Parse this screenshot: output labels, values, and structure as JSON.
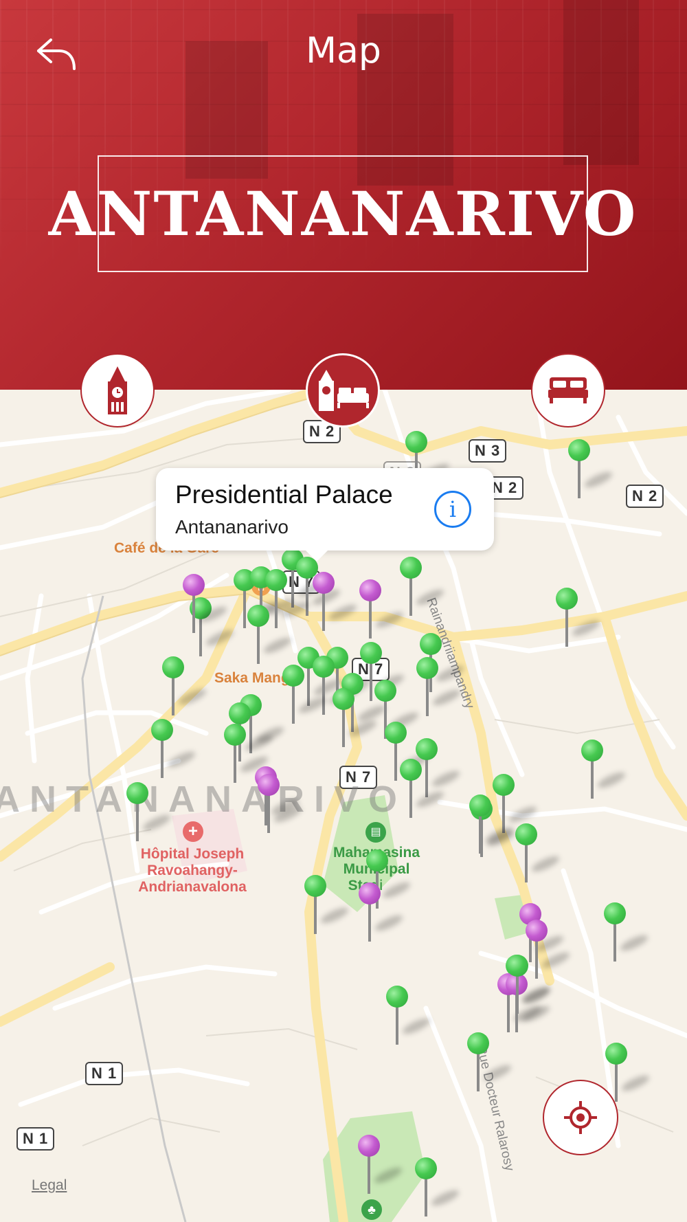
{
  "header": {
    "title": "Map",
    "city": "ANTANANARIVO",
    "back_icon": "back-arrow-icon"
  },
  "categories": [
    {
      "name": "attractions",
      "icon": "clock-tower-icon",
      "active": false
    },
    {
      "name": "attractions-and-hotels",
      "icon": "clock-tower-bed-icon",
      "active": true
    },
    {
      "name": "hotels",
      "icon": "bed-icon",
      "active": false
    }
  ],
  "map": {
    "callout": {
      "title": "Presidential Palace",
      "subtitle": "Antananarivo",
      "info_icon": "info-icon"
    },
    "road_labels": {
      "n2a": "N 2",
      "n3a": "N 3",
      "n3b": "N 3",
      "n2b": "N 2",
      "n2c": "N 2",
      "n7a": "N 7",
      "n7b": "N 7",
      "n7c": "N 7",
      "n1a": "N 1",
      "n1b": "N 1"
    },
    "places": {
      "cafe": "Café de la Gare",
      "market": "Saka Manga",
      "hospital_1": "Hôpital Joseph",
      "hospital_2": "Ravoahangy-",
      "hospital_3": "Andrianavalona",
      "stadium_1": "Mahamasina",
      "stadium_2": "Municipal",
      "stadium_3": "Stadium",
      "street_1": "Rainandriiampandry",
      "street_2": "Rue Docteur Ralarosy"
    },
    "area_watermark": "ANTANANARIVO",
    "legal": "Legal",
    "colors": {
      "green_pin": "#46c950",
      "purple_pin": "#c45bd0",
      "accent": "#b0262d"
    },
    "locate_icon": "crosshair-icon"
  }
}
